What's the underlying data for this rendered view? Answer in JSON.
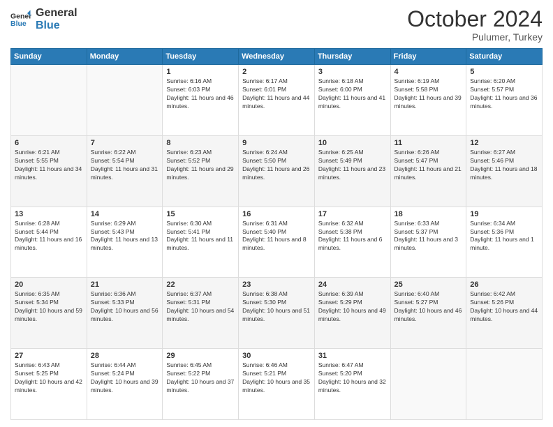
{
  "header": {
    "logo_line1": "General",
    "logo_line2": "Blue",
    "month_title": "October 2024",
    "location": "Pulumer, Turkey"
  },
  "days_of_week": [
    "Sunday",
    "Monday",
    "Tuesday",
    "Wednesday",
    "Thursday",
    "Friday",
    "Saturday"
  ],
  "weeks": [
    [
      {
        "day": "",
        "info": ""
      },
      {
        "day": "",
        "info": ""
      },
      {
        "day": "1",
        "info": "Sunrise: 6:16 AM\nSunset: 6:03 PM\nDaylight: 11 hours and 46 minutes."
      },
      {
        "day": "2",
        "info": "Sunrise: 6:17 AM\nSunset: 6:01 PM\nDaylight: 11 hours and 44 minutes."
      },
      {
        "day": "3",
        "info": "Sunrise: 6:18 AM\nSunset: 6:00 PM\nDaylight: 11 hours and 41 minutes."
      },
      {
        "day": "4",
        "info": "Sunrise: 6:19 AM\nSunset: 5:58 PM\nDaylight: 11 hours and 39 minutes."
      },
      {
        "day": "5",
        "info": "Sunrise: 6:20 AM\nSunset: 5:57 PM\nDaylight: 11 hours and 36 minutes."
      }
    ],
    [
      {
        "day": "6",
        "info": "Sunrise: 6:21 AM\nSunset: 5:55 PM\nDaylight: 11 hours and 34 minutes."
      },
      {
        "day": "7",
        "info": "Sunrise: 6:22 AM\nSunset: 5:54 PM\nDaylight: 11 hours and 31 minutes."
      },
      {
        "day": "8",
        "info": "Sunrise: 6:23 AM\nSunset: 5:52 PM\nDaylight: 11 hours and 29 minutes."
      },
      {
        "day": "9",
        "info": "Sunrise: 6:24 AM\nSunset: 5:50 PM\nDaylight: 11 hours and 26 minutes."
      },
      {
        "day": "10",
        "info": "Sunrise: 6:25 AM\nSunset: 5:49 PM\nDaylight: 11 hours and 23 minutes."
      },
      {
        "day": "11",
        "info": "Sunrise: 6:26 AM\nSunset: 5:47 PM\nDaylight: 11 hours and 21 minutes."
      },
      {
        "day": "12",
        "info": "Sunrise: 6:27 AM\nSunset: 5:46 PM\nDaylight: 11 hours and 18 minutes."
      }
    ],
    [
      {
        "day": "13",
        "info": "Sunrise: 6:28 AM\nSunset: 5:44 PM\nDaylight: 11 hours and 16 minutes."
      },
      {
        "day": "14",
        "info": "Sunrise: 6:29 AM\nSunset: 5:43 PM\nDaylight: 11 hours and 13 minutes."
      },
      {
        "day": "15",
        "info": "Sunrise: 6:30 AM\nSunset: 5:41 PM\nDaylight: 11 hours and 11 minutes."
      },
      {
        "day": "16",
        "info": "Sunrise: 6:31 AM\nSunset: 5:40 PM\nDaylight: 11 hours and 8 minutes."
      },
      {
        "day": "17",
        "info": "Sunrise: 6:32 AM\nSunset: 5:38 PM\nDaylight: 11 hours and 6 minutes."
      },
      {
        "day": "18",
        "info": "Sunrise: 6:33 AM\nSunset: 5:37 PM\nDaylight: 11 hours and 3 minutes."
      },
      {
        "day": "19",
        "info": "Sunrise: 6:34 AM\nSunset: 5:36 PM\nDaylight: 11 hours and 1 minute."
      }
    ],
    [
      {
        "day": "20",
        "info": "Sunrise: 6:35 AM\nSunset: 5:34 PM\nDaylight: 10 hours and 59 minutes."
      },
      {
        "day": "21",
        "info": "Sunrise: 6:36 AM\nSunset: 5:33 PM\nDaylight: 10 hours and 56 minutes."
      },
      {
        "day": "22",
        "info": "Sunrise: 6:37 AM\nSunset: 5:31 PM\nDaylight: 10 hours and 54 minutes."
      },
      {
        "day": "23",
        "info": "Sunrise: 6:38 AM\nSunset: 5:30 PM\nDaylight: 10 hours and 51 minutes."
      },
      {
        "day": "24",
        "info": "Sunrise: 6:39 AM\nSunset: 5:29 PM\nDaylight: 10 hours and 49 minutes."
      },
      {
        "day": "25",
        "info": "Sunrise: 6:40 AM\nSunset: 5:27 PM\nDaylight: 10 hours and 46 minutes."
      },
      {
        "day": "26",
        "info": "Sunrise: 6:42 AM\nSunset: 5:26 PM\nDaylight: 10 hours and 44 minutes."
      }
    ],
    [
      {
        "day": "27",
        "info": "Sunrise: 6:43 AM\nSunset: 5:25 PM\nDaylight: 10 hours and 42 minutes."
      },
      {
        "day": "28",
        "info": "Sunrise: 6:44 AM\nSunset: 5:24 PM\nDaylight: 10 hours and 39 minutes."
      },
      {
        "day": "29",
        "info": "Sunrise: 6:45 AM\nSunset: 5:22 PM\nDaylight: 10 hours and 37 minutes."
      },
      {
        "day": "30",
        "info": "Sunrise: 6:46 AM\nSunset: 5:21 PM\nDaylight: 10 hours and 35 minutes."
      },
      {
        "day": "31",
        "info": "Sunrise: 6:47 AM\nSunset: 5:20 PM\nDaylight: 10 hours and 32 minutes."
      },
      {
        "day": "",
        "info": ""
      },
      {
        "day": "",
        "info": ""
      }
    ]
  ]
}
